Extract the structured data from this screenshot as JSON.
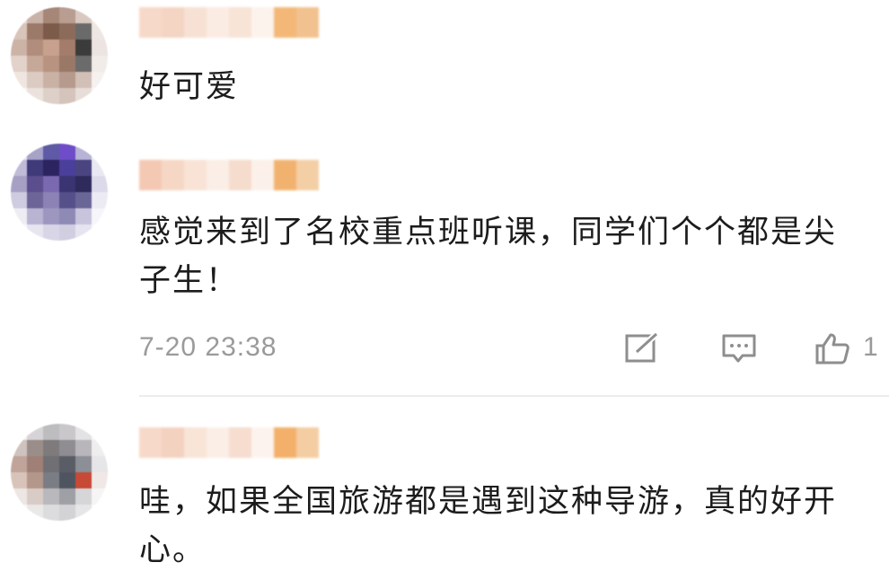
{
  "comments": [
    {
      "text": "好可爱",
      "avatar_colors": [
        "#e8dcd6",
        "#c9b3a8",
        "#a58677",
        "#b89d90",
        "#dac9c1",
        "#f0e8e4",
        "#d8c4ba",
        "#9c7a6a",
        "#7d5b4b",
        "#8c6b5b",
        "#6a6a6a",
        "#eee6e2",
        "#cbb3a6",
        "#b08d7c",
        "#c8a08e",
        "#a47c6c",
        "#3b3b3b",
        "#ece4e0",
        "#e2d2ca",
        "#c6a898",
        "#b8937f",
        "#9a7868",
        "#6b6b6b",
        "#f2ece9",
        "#efe6e2",
        "#dccbc2",
        "#c9b1a4",
        "#b59a8d",
        "#d2c0b7",
        "#f5f1ef",
        "#f8f5f3",
        "#ebe2dd",
        "#ddd0c9",
        "#d4c4bb",
        "#e8ded9",
        "#faf8f7"
      ]
    },
    {
      "text": "感觉来到了名校重点班听课，同学们个个都是尖子生！",
      "time": "7-20 23:38",
      "like_count": "1",
      "avatar_colors": [
        "#e6e4ef",
        "#a7a2c8",
        "#5f5aa5",
        "#6f4cc8",
        "#b6b3d6",
        "#f1f0f6",
        "#c0bcd8",
        "#3f3a7a",
        "#2b2460",
        "#4a3f9a",
        "#4a4580",
        "#e9e8f2",
        "#a6a1c4",
        "#5b4d8e",
        "#7a68b0",
        "#3a3472",
        "#2e2a5c",
        "#dcdaea",
        "#cfcbe0",
        "#6d6598",
        "#8c82b6",
        "#55508a",
        "#6a6698",
        "#eceaf3",
        "#eeedf4",
        "#b9b4d2",
        "#9d97c0",
        "#8f89b5",
        "#c8c4dc",
        "#f6f5f9",
        "#f9f8fb",
        "#e7e5f0",
        "#d8d5e6",
        "#d2cee2",
        "#e6e4ef",
        "#fbfbfd"
      ],
      "colors": {
        "icon": "#8e8e8e",
        "meta": "#9a9a9a"
      },
      "icons": [
        "edit-icon",
        "comment-icon",
        "like-icon"
      ]
    },
    {
      "text": "哇，如果全国旅游都是遇到这种导游，真的好开心。",
      "avatar_colors": [
        "#f1efef",
        "#d6d4d6",
        "#bdbcbf",
        "#c9c7ca",
        "#e3e2e4",
        "#f7f6f7",
        "#cfc3c0",
        "#9b8e8a",
        "#7f7a7c",
        "#8f8d92",
        "#b8b6ba",
        "#efeeef",
        "#c0a49a",
        "#a08076",
        "#6f6f74",
        "#5a5d66",
        "#8d8f96",
        "#e6e5e7",
        "#d8c3ba",
        "#b4978b",
        "#7b7d84",
        "#4f5560",
        "#c64a35",
        "#efe8e6",
        "#ede6e3",
        "#d9ccc6",
        "#b9b8bc",
        "#9fa0a6",
        "#d6d5d8",
        "#f6f4f4",
        "#f8f7f7",
        "#ebe8e8",
        "#dcdbdd",
        "#d3d2d5",
        "#e6e5e7",
        "#fbfafa"
      ]
    }
  ]
}
